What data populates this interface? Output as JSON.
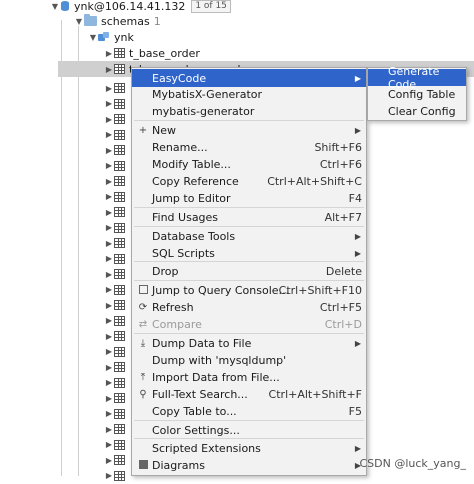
{
  "tree": {
    "connection": {
      "label": "ynk@106.14.41.132",
      "badge": "1 of 15"
    },
    "schemas": {
      "label": "schemas",
      "count": "1"
    },
    "schema": {
      "label": "ynk"
    },
    "tables": [
      {
        "label": "t_base_order"
      },
      {
        "label": "t_base_order_record"
      }
    ]
  },
  "menu": {
    "items": [
      {
        "label": "EasyCode",
        "shortcut": "",
        "submenu": true,
        "icon": ""
      },
      {
        "label": "MybatisX-Generator",
        "shortcut": "",
        "submenu": false,
        "icon": ""
      },
      {
        "label": "mybatis-generator",
        "shortcut": "",
        "submenu": false,
        "icon": ""
      },
      {
        "label": "New",
        "shortcut": "",
        "submenu": true,
        "icon": "plus-icon"
      },
      {
        "label": "Rename...",
        "shortcut": "Shift+F6",
        "submenu": false,
        "icon": ""
      },
      {
        "label": "Modify Table...",
        "shortcut": "Ctrl+F6",
        "submenu": false,
        "icon": ""
      },
      {
        "label": "Copy Reference",
        "shortcut": "Ctrl+Alt+Shift+C",
        "submenu": false,
        "icon": ""
      },
      {
        "label": "Jump to Editor",
        "shortcut": "F4",
        "submenu": false,
        "icon": ""
      },
      {
        "label": "Find Usages",
        "shortcut": "Alt+F7",
        "submenu": false,
        "icon": ""
      },
      {
        "label": "Database Tools",
        "shortcut": "",
        "submenu": true,
        "icon": ""
      },
      {
        "label": "SQL Scripts",
        "shortcut": "",
        "submenu": true,
        "icon": ""
      },
      {
        "label": "Drop",
        "shortcut": "Delete",
        "submenu": false,
        "icon": ""
      },
      {
        "label": "Jump to Query Console...",
        "shortcut": "Ctrl+Shift+F10",
        "submenu": false,
        "icon": "console-icon"
      },
      {
        "label": "Refresh",
        "shortcut": "Ctrl+F5",
        "submenu": false,
        "icon": "refresh-icon"
      },
      {
        "label": "Compare",
        "shortcut": "Ctrl+D",
        "submenu": false,
        "icon": "compare-icon",
        "disabled": true
      },
      {
        "label": "Dump Data to File",
        "shortcut": "",
        "submenu": true,
        "icon": "download-icon"
      },
      {
        "label": "Dump with 'mysqldump'",
        "shortcut": "",
        "submenu": false,
        "icon": ""
      },
      {
        "label": "Import Data from File...",
        "shortcut": "",
        "submenu": false,
        "icon": "upload-icon"
      },
      {
        "label": "Full-Text Search...",
        "shortcut": "Ctrl+Alt+Shift+F",
        "submenu": false,
        "icon": "search-icon"
      },
      {
        "label": "Copy Table to...",
        "shortcut": "F5",
        "submenu": false,
        "icon": ""
      },
      {
        "label": "Color Settings...",
        "shortcut": "",
        "submenu": false,
        "icon": ""
      },
      {
        "label": "Scripted Extensions",
        "shortcut": "",
        "submenu": true,
        "icon": ""
      },
      {
        "label": "Diagrams",
        "shortcut": "",
        "submenu": true,
        "icon": "diagram-icon"
      }
    ]
  },
  "submenu": {
    "items": [
      {
        "label": "Generate Code"
      },
      {
        "label": "Config Table"
      },
      {
        "label": "Clear Config"
      }
    ]
  },
  "watermark": "CSDN @luck_yang_",
  "colors": {
    "highlight": "#2f65ca",
    "menu_bg": "#f2f2f2",
    "selected_row": "#cfcfcf"
  }
}
